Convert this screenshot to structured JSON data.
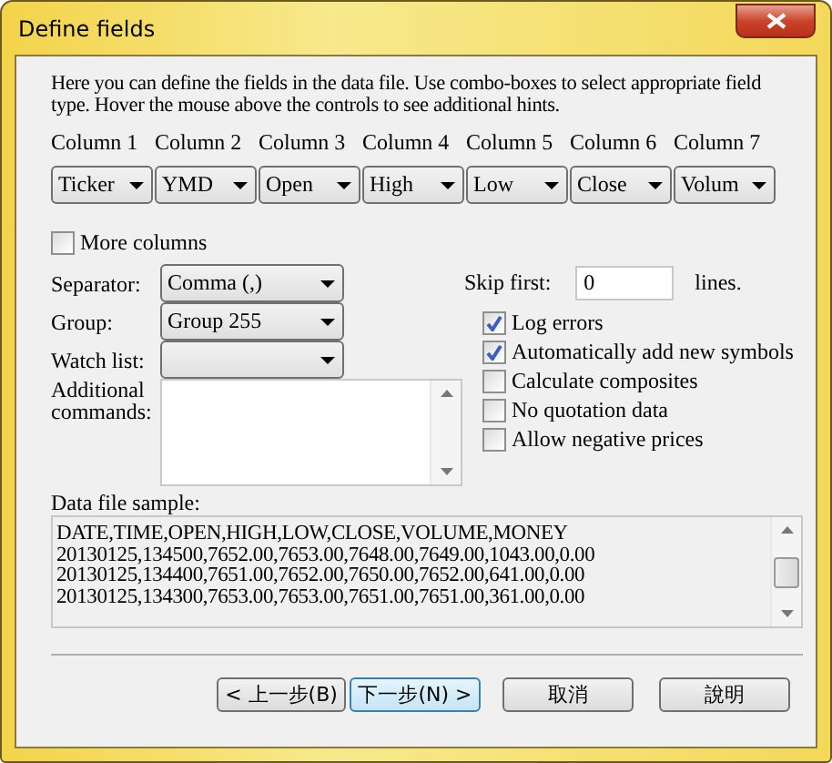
{
  "window": {
    "title": "Define fields"
  },
  "intro": "Here you can define the fields in the data file. Use combo-boxes to select appropriate field type. Hover the mouse above the controls to see additional hints.",
  "columns": [
    {
      "label": "Column 1",
      "value": "Ticker"
    },
    {
      "label": "Column 2",
      "value": "YMD"
    },
    {
      "label": "Column 3",
      "value": "Open"
    },
    {
      "label": "Column 4",
      "value": "High"
    },
    {
      "label": "Column 5",
      "value": "Low"
    },
    {
      "label": "Column 6",
      "value": "Close"
    },
    {
      "label": "Column 7",
      "value": "Volum"
    }
  ],
  "more_columns": {
    "label": "More columns",
    "checked": false
  },
  "separator": {
    "label": "Separator:",
    "value": "Comma (,)"
  },
  "group": {
    "label": "Group:",
    "value": "Group 255"
  },
  "watch_list": {
    "label": "Watch list:"
  },
  "additional_commands": {
    "label": "Additional commands:"
  },
  "skip_first": {
    "label": "Skip first:",
    "value": "0",
    "suffix": "lines."
  },
  "options": [
    {
      "label": "Log errors",
      "checked": true
    },
    {
      "label": "Automatically add new symbols",
      "checked": true
    },
    {
      "label": "Calculate composites",
      "checked": false
    },
    {
      "label": "No quotation data",
      "checked": false
    },
    {
      "label": "Allow negative prices",
      "checked": false
    }
  ],
  "sample": {
    "label": "Data file sample:",
    "lines": [
      "DATE,TIME,OPEN,HIGH,LOW,CLOSE,VOLUME,MONEY",
      "20130125,134500,7652.00,7653.00,7648.00,7649.00,1043.00,0.00",
      "20130125,134400,7651.00,7652.00,7650.00,7652.00,641.00,0.00",
      "20130125,134300,7653.00,7653.00,7651.00,7651.00,361.00,0.00"
    ]
  },
  "buttons": [
    {
      "label": "< 上一步(B)",
      "default": false
    },
    {
      "label": "下一步(N) >",
      "default": true
    },
    {
      "label": "取消",
      "default": false
    },
    {
      "label": "說明",
      "default": false
    }
  ]
}
